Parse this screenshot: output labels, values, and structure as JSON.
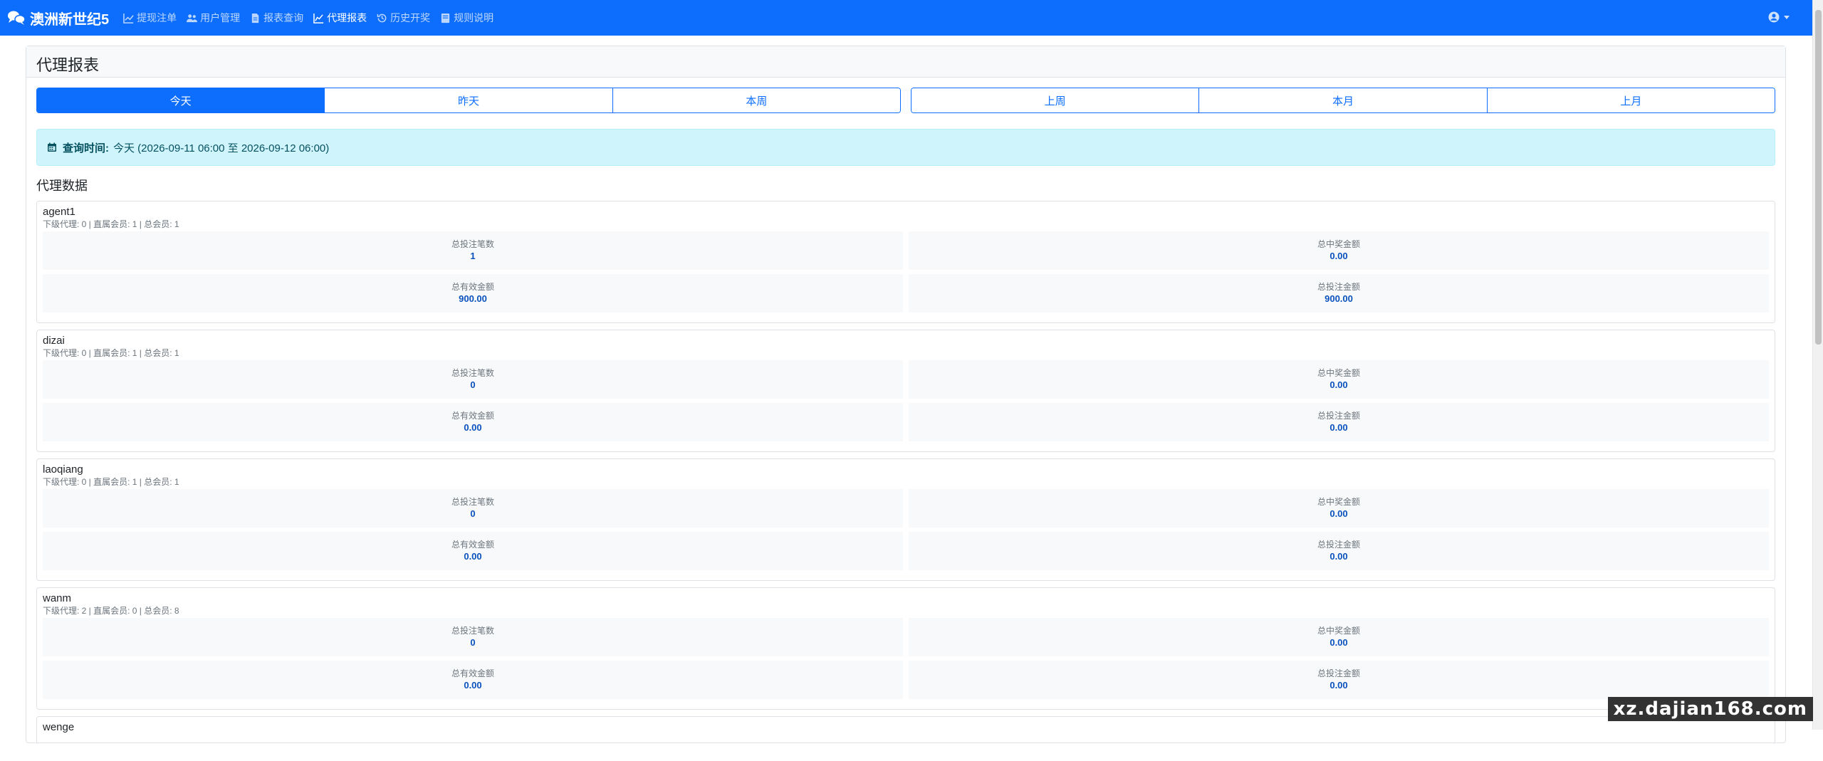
{
  "nav": {
    "brand": "澳洲新世纪5",
    "items": [
      {
        "label": "提现注单",
        "icon": "chart-line-icon",
        "active": false
      },
      {
        "label": "用户管理",
        "icon": "users-icon",
        "active": false
      },
      {
        "label": "报表查询",
        "icon": "document-icon",
        "active": false
      },
      {
        "label": "代理报表",
        "icon": "chart-bar-icon",
        "active": true
      },
      {
        "label": "历史开奖",
        "icon": "history-icon",
        "active": false
      },
      {
        "label": "规则说明",
        "icon": "book-icon",
        "active": false
      }
    ]
  },
  "page": {
    "title": "代理报表",
    "period_group_1": [
      "今天",
      "昨天",
      "本周"
    ],
    "period_group_2": [
      "上周",
      "本月",
      "上月"
    ],
    "active_period": "今天",
    "query_label": "查询时间:",
    "query_value": "今天 (2026-09-11 06:00 至 2026-09-12 06:00)",
    "section_title": "代理数据",
    "stat_labels": {
      "bet_count": "总投注笔数",
      "win_amount": "总中奖金额",
      "valid_amount": "总有效金额",
      "bet_amount": "总投注金额"
    },
    "agents": [
      {
        "name": "agent1",
        "meta": "下级代理: 0 | 直属会员: 1 | 总会员: 1",
        "bet_count": "1",
        "win_amount": "0.00",
        "valid_amount": "900.00",
        "bet_amount": "900.00"
      },
      {
        "name": "dizai",
        "meta": "下级代理: 0 | 直属会员: 1 | 总会员: 1",
        "bet_count": "0",
        "win_amount": "0.00",
        "valid_amount": "0.00",
        "bet_amount": "0.00"
      },
      {
        "name": "laoqiang",
        "meta": "下级代理: 0 | 直属会员: 1 | 总会员: 1",
        "bet_count": "0",
        "win_amount": "0.00",
        "valid_amount": "0.00",
        "bet_amount": "0.00"
      },
      {
        "name": "wanm",
        "meta": "下级代理: 2 | 直属会员: 0 | 总会员: 8",
        "bet_count": "0",
        "win_amount": "0.00",
        "valid_amount": "0.00",
        "bet_amount": "0.00"
      },
      {
        "name": "wenge"
      }
    ]
  },
  "watermark": "xz.dajian168.com",
  "colors": {
    "primary": "#0d6efd",
    "alert_bg": "#cff4fc",
    "alert_text": "#055160"
  }
}
